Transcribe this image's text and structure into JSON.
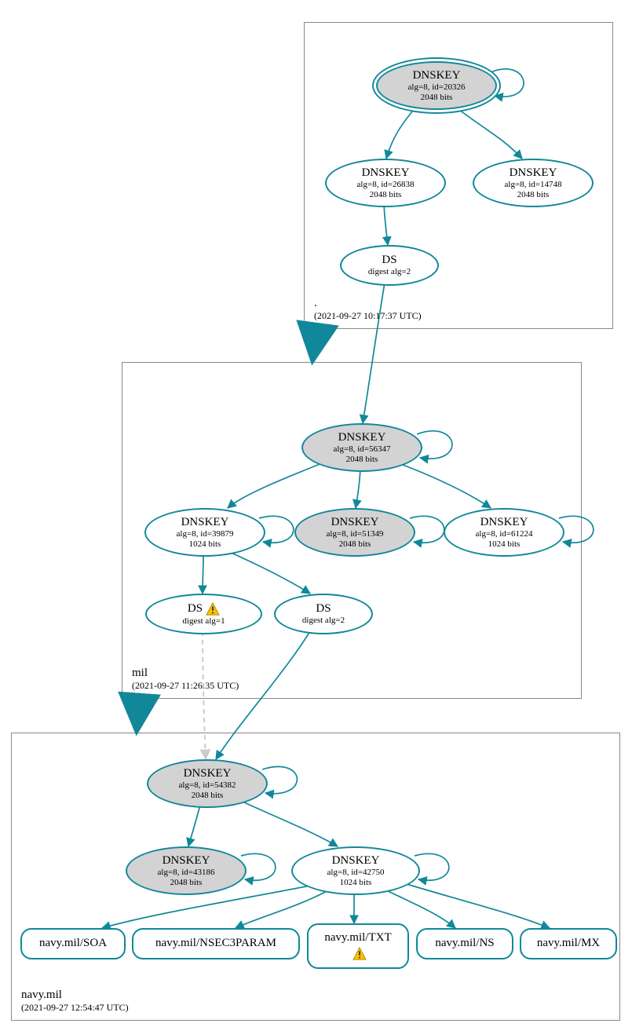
{
  "zones": {
    "root": {
      "name": ".",
      "timestamp": "(2021-09-27 10:17:37 UTC)"
    },
    "mil": {
      "name": "mil",
      "timestamp": "(2021-09-27 11:26:35 UTC)"
    },
    "navy": {
      "name": "navy.mil",
      "timestamp": "(2021-09-27 12:54:47 UTC)"
    }
  },
  "nodes": {
    "root_ksk": {
      "title": "DNSKEY",
      "line2": "alg=8, id=20326",
      "line3": "2048 bits"
    },
    "root_zsk1": {
      "title": "DNSKEY",
      "line2": "alg=8, id=26838",
      "line3": "2048 bits"
    },
    "root_zsk2": {
      "title": "DNSKEY",
      "line2": "alg=8, id=14748",
      "line3": "2048 bits"
    },
    "root_ds": {
      "title": "DS",
      "line2": "digest alg=2"
    },
    "mil_ksk": {
      "title": "DNSKEY",
      "line2": "alg=8, id=56347",
      "line3": "2048 bits"
    },
    "mil_k1": {
      "title": "DNSKEY",
      "line2": "alg=8, id=39879",
      "line3": "1024 bits"
    },
    "mil_k2": {
      "title": "DNSKEY",
      "line2": "alg=8, id=51349",
      "line3": "2048 bits"
    },
    "mil_k3": {
      "title": "DNSKEY",
      "line2": "alg=8, id=61224",
      "line3": "1024 bits"
    },
    "mil_ds1": {
      "title": "DS",
      "line2": "digest alg=1"
    },
    "mil_ds2": {
      "title": "DS",
      "line2": "digest alg=2"
    },
    "navy_ksk": {
      "title": "DNSKEY",
      "line2": "alg=8, id=54382",
      "line3": "2048 bits"
    },
    "navy_k1": {
      "title": "DNSKEY",
      "line2": "alg=8, id=43186",
      "line3": "2048 bits"
    },
    "navy_k2": {
      "title": "DNSKEY",
      "line2": "alg=8, id=42750",
      "line3": "1024 bits"
    },
    "rr_soa": {
      "title": "navy.mil/SOA"
    },
    "rr_nsec": {
      "title": "navy.mil/NSEC3PARAM"
    },
    "rr_txt": {
      "title": "navy.mil/TXT"
    },
    "rr_ns": {
      "title": "navy.mil/NS"
    },
    "rr_mx": {
      "title": "navy.mil/MX"
    }
  }
}
